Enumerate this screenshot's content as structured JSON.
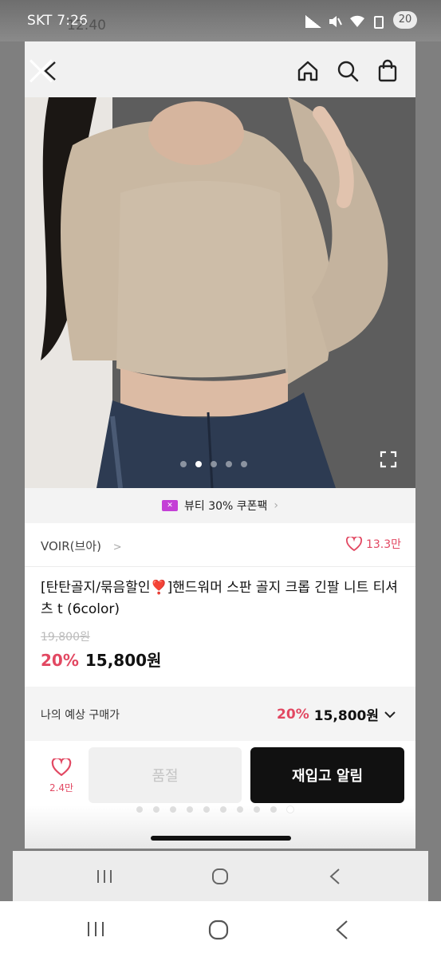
{
  "status_bar": {
    "carrier_time": "SKT 7:26",
    "inner_time": "12:40",
    "battery_badge": "20"
  },
  "top_bar": {
    "icons": [
      "close-icon",
      "back-icon",
      "home-icon",
      "search-icon",
      "cart-icon"
    ]
  },
  "hero": {
    "image_count": 5,
    "active_index": 2
  },
  "coupon_banner": {
    "label": "뷰티 30% 쿠폰팩",
    "icon_text": "✕"
  },
  "brand": {
    "name": "VOIR(브아)",
    "chevron": ">",
    "like_count": "13.3만"
  },
  "product": {
    "title": "[탄탄골지/묶음할인❣️]핸드워머 스판 골지 크롭 긴팔 니트 티셔츠 t (6color)",
    "original_price": "19,800원",
    "discount": "20%",
    "price": "15,800원"
  },
  "expected_price": {
    "label": "나의 예상 구매가",
    "discount": "20%",
    "price": "15,800원"
  },
  "bottom_bar": {
    "wish_count": "2.4만",
    "soldout_label": "품절",
    "restock_label": "재입고 알림",
    "page_dots": 10,
    "page_active": 10
  },
  "colors": {
    "accent": "#e24862",
    "dark_button": "#111111",
    "coupon_purple": "#c43fd6"
  }
}
